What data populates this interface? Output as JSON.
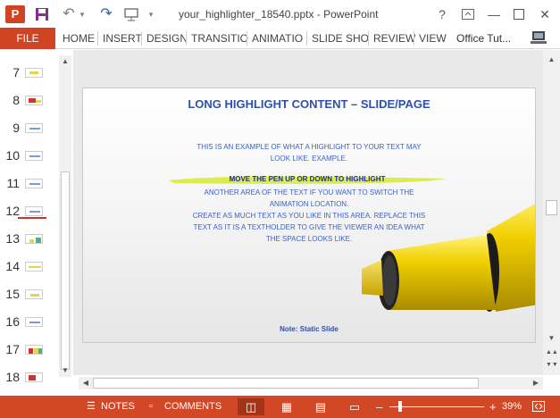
{
  "app": {
    "window_title": "your_highlighter_18540.pptx - PowerPoint",
    "logo_letter": "P",
    "help": "?",
    "minimize": "—",
    "close": "✕"
  },
  "ribbon": {
    "file": "FILE",
    "tabs": [
      "HOME",
      "INSERT",
      "DESIGN",
      "TRANSITIO",
      "ANIMATIO",
      "SLIDE SHO",
      "REVIEW",
      "VIEW"
    ],
    "user": "Office Tut..."
  },
  "thumbnails": {
    "numbers": [
      "7",
      "8",
      "9",
      "10",
      "11",
      "12",
      "13",
      "14",
      "15",
      "16",
      "17",
      "18"
    ]
  },
  "slide": {
    "title": "LONG HIGHLIGHT CONTENT – SLIDE/PAGE",
    "para1_line1": "THIS IS AN EXAMPLE OF WHAT A HIGHLIGHT TO YOUR TEXT MAY",
    "para1_line2": "LOOK LIKE. EXAMPLE.",
    "highlight": "MOVE THE PEN UP OR DOWN TO HIGHLIGHT",
    "para2_line1": "ANOTHER AREA OF THE TEXT IF YOU WANT TO SWITCH THE",
    "para2_line2": "ANIMATION LOCATION.",
    "para3_line1": "CREATE AS MUCH TEXT AS YOU LIKE IN THIS AREA. REPLACE THIS",
    "para3_line2": "TEXT AS IT IS A TEXTHOLDER TO GIVE THE VIEWER AN IDEA WHAT",
    "para3_line3": "THE SPACE LOOKS LIKE.",
    "note": "Note: Static Slide"
  },
  "status": {
    "notes": "NOTES",
    "comments": "COMMENTS",
    "zoom": "39%"
  },
  "colors": {
    "accent": "#d24726",
    "title_blue": "#2f4fae",
    "highlight_yellow": "#d8ea3a",
    "marker_yellow": "#f2d000"
  }
}
